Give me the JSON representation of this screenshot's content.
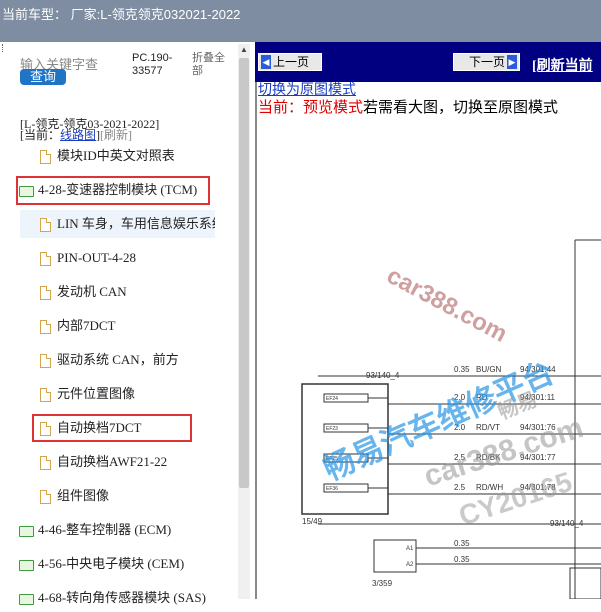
{
  "header": {
    "title": "当前车型：  厂家:L-领克领克032021-2022"
  },
  "search": {
    "label": "输入关键字查",
    "button": "查询"
  },
  "pc_code": "PC.190-33577",
  "fold_all": "折叠全部",
  "model_line": "[L-领克-领克03-2021-2022]",
  "current": {
    "prefix": "[当前：",
    "mode": "线路图",
    "suffix": "]",
    "refresh": "[刷新]"
  },
  "tree": [
    {
      "label": "模块ID中英文对照表",
      "type": "doc"
    },
    {
      "label": "4-28-变速器控制模块 (TCM)",
      "type": "folder"
    },
    {
      "label": "LIN 车身，车用信息娱乐系统，",
      "type": "doc"
    },
    {
      "label": "PIN-OUT-4-28",
      "type": "doc"
    },
    {
      "label": "发动机 CAN",
      "type": "doc"
    },
    {
      "label": "内部7DCT",
      "type": "doc"
    },
    {
      "label": "驱动系统 CAN，前方",
      "type": "doc"
    },
    {
      "label": "元件位置图像",
      "type": "doc"
    },
    {
      "label": "自动换档7DCT",
      "type": "doc"
    },
    {
      "label": "自动换档AWF21-22",
      "type": "doc"
    },
    {
      "label": "组件图像",
      "type": "doc"
    },
    {
      "label": "4-46-整车控制器 (ECM)",
      "type": "folder"
    },
    {
      "label": "4-56-中央电子模块 (CEM)",
      "type": "folder"
    },
    {
      "label": "4-68-转向角传感器模块 (SAS)",
      "type": "folder"
    }
  ],
  "nav": {
    "prev": "上一页",
    "next": "下一页",
    "refresh": "[刷新当前"
  },
  "switch_link": "切换为原图模式",
  "preview": {
    "red": "当前：预览模式",
    "rest": "若需看大图，切换至原图模式"
  },
  "diagram": {
    "connector_left": "93/140_4",
    "wires": [
      {
        "size": "0.35",
        "color": "BU/GN",
        "pin": "94/301:44"
      },
      {
        "size": "2.0",
        "color": "RD",
        "pin": "94/301:11"
      },
      {
        "size": "2.0",
        "color": "RD/VT",
        "pin": "94/301:76"
      },
      {
        "size": "2.5",
        "color": "RD/BK",
        "pin": "94/301:77"
      },
      {
        "size": "2.5",
        "color": "RD/WH",
        "pin": "94/301:78"
      }
    ],
    "fuses": [
      "EF24",
      "EF23",
      "EF25",
      "EF36"
    ],
    "box_label": "15/49",
    "bottom_connector": "93/140_4",
    "relay_wires": [
      "0.35",
      "0.35"
    ],
    "relay_pins": [
      "A1",
      "A2"
    ],
    "relay_label": "3/359"
  },
  "watermarks": {
    "car388": "car388.com",
    "brand": "畅易汽车维修平台",
    "small": "畅易",
    "car388b": "car388.com",
    "code": "CY20165"
  }
}
